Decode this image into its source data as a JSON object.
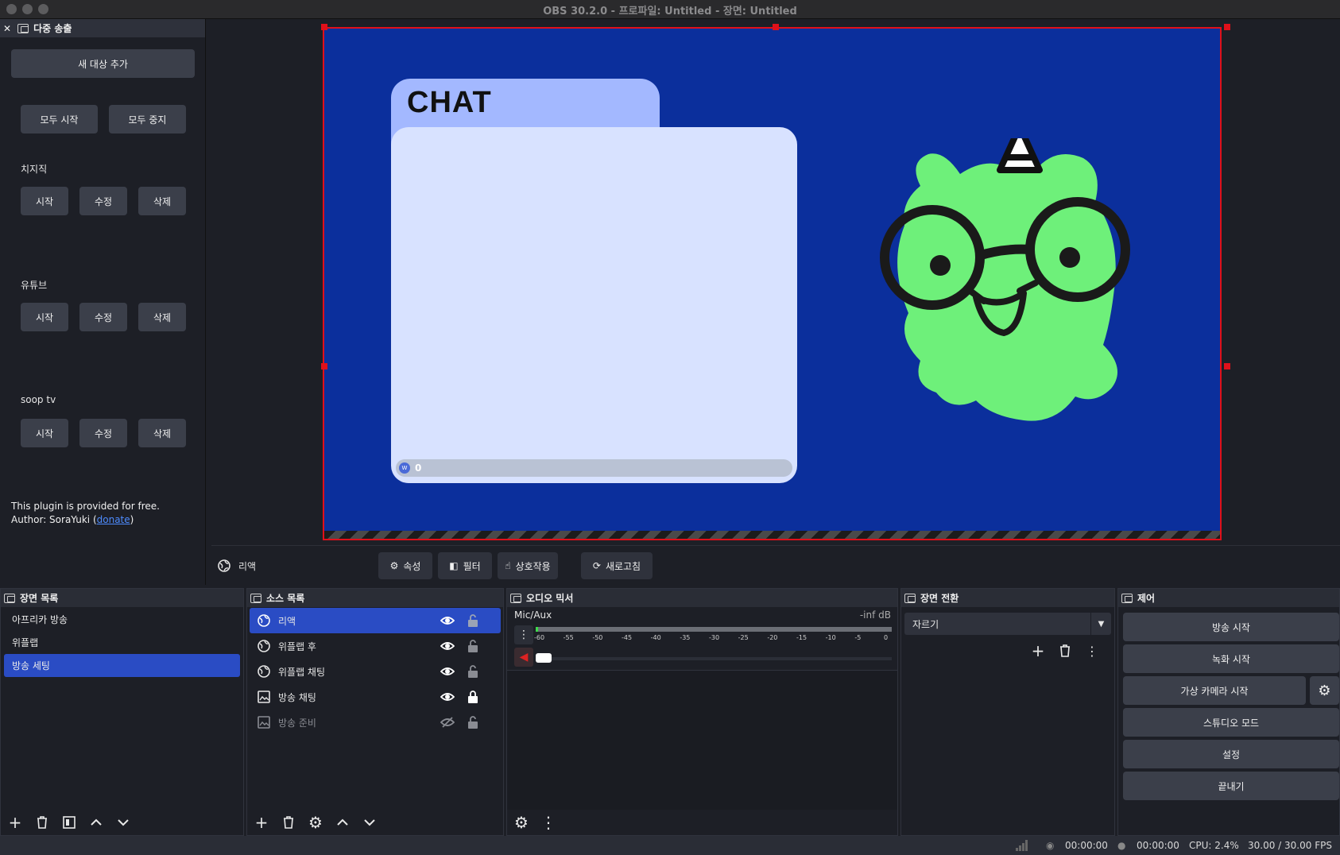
{
  "window": {
    "title": "OBS 30.2.0 - 프로파일: Untitled - 장면: Untitled"
  },
  "multistream": {
    "title": "다중 송출",
    "add_target": "새 대상 추가",
    "start_all": "모두 시작",
    "stop_all": "모두 중지",
    "targets": [
      {
        "name": "치지직",
        "start": "시작",
        "edit": "수정",
        "delete": "삭제"
      },
      {
        "name": "유튜브",
        "start": "시작",
        "edit": "수정",
        "delete": "삭제"
      },
      {
        "name": "soop tv",
        "start": "시작",
        "edit": "수정",
        "delete": "삭제"
      }
    ],
    "footnote_line1": "This plugin is provided for free.",
    "footnote_author": "Author: SoraYuki (",
    "footnote_link": "donate",
    "footnote_close": ")"
  },
  "preview": {
    "chat_title": "CHAT",
    "chat_count": "0",
    "chat_badge": "W"
  },
  "source_toolbar": {
    "source_name": "리액",
    "properties": "속성",
    "filters": "필터",
    "interact": "상호작용",
    "refresh": "새로고침"
  },
  "scenes": {
    "title": "장면 목록",
    "items": [
      "아프리카 방송",
      "위플랩",
      "방송 세팅"
    ],
    "selected": 2
  },
  "sources": {
    "title": "소스 목록",
    "items": [
      {
        "name": "리액",
        "type": "browser",
        "visible": true,
        "locked": false,
        "selected": true
      },
      {
        "name": "위플랩 후",
        "type": "browser",
        "visible": true,
        "locked": false
      },
      {
        "name": "위플랩 채팅",
        "type": "browser",
        "visible": true,
        "locked": false
      },
      {
        "name": "방송 채팅",
        "type": "image",
        "visible": true,
        "locked": true
      },
      {
        "name": "방송 준비",
        "type": "image",
        "visible": false,
        "locked": false
      }
    ]
  },
  "mixer": {
    "title": "오디오 믹서",
    "channel": "Mic/Aux",
    "level": "-inf dB",
    "ticks": [
      "-60",
      "-55",
      "-50",
      "-45",
      "-40",
      "-35",
      "-30",
      "-25",
      "-20",
      "-15",
      "-10",
      "-5",
      "0"
    ]
  },
  "transitions": {
    "title": "장면 전환",
    "selected": "자르기"
  },
  "controls": {
    "title": "제어",
    "start_stream": "방송 시작",
    "start_record": "녹화 시작",
    "virtual_cam": "가상 카메라 시작",
    "studio_mode": "스튜디오 모드",
    "settings": "설정",
    "exit": "끝내기"
  },
  "status": {
    "stream_time": "00:00:00",
    "record_time": "00:00:00",
    "cpu": "CPU: 2.4%",
    "fps": "30.00 / 30.00 FPS"
  },
  "colors": {
    "canvas_bg": "#0b2f9c",
    "selection": "#e0101a",
    "list_selected": "#2a4cc4",
    "mascot": "#6ef07a"
  }
}
